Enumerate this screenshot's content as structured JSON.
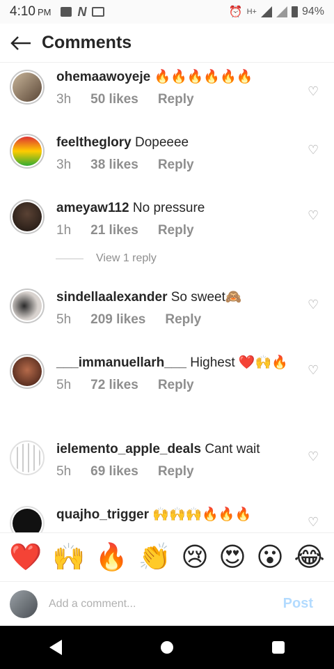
{
  "status": {
    "time": "4:10",
    "ampm": "PM",
    "network": "H+",
    "battery": "94%"
  },
  "header": {
    "title": "Comments"
  },
  "comments": [
    {
      "user": "ohemaawoyeje",
      "text": "🔥🔥🔥🔥🔥🔥",
      "time": "3h",
      "likes": "50 likes",
      "reply": "Reply",
      "avatar_color": "#8a7560"
    },
    {
      "user": "feeltheglory",
      "text": "Dopeeee",
      "time": "3h",
      "likes": "38 likes",
      "reply": "Reply",
      "avatar_color": "#6b7a3c"
    },
    {
      "user": "ameyaw112",
      "text": "No pressure",
      "time": "1h",
      "likes": "21 likes",
      "reply": "Reply",
      "avatar_color": "#3b2b22"
    },
    {
      "user": "sindellaalexander",
      "text": "So sweet🙈",
      "time": "5h",
      "likes": "209 likes",
      "reply": "Reply",
      "avatar_color": "#c7b8b0"
    },
    {
      "user": "___immanuellarh___",
      "text": "Highest ❤️🙌🔥",
      "time": "5h",
      "likes": "72 likes",
      "reply": "Reply",
      "avatar_color": "#7a3a2a"
    },
    {
      "user": "ielemento_apple_deals",
      "text": "Cant wait",
      "time": "5h",
      "likes": "69 likes",
      "reply": "Reply",
      "avatar_color": "#e8e8e8"
    },
    {
      "user": "quajho_trigger",
      "text": "🙌🙌🙌🔥🔥🔥",
      "time": "",
      "likes": "",
      "reply": "",
      "avatar_color": "#111111"
    }
  ],
  "view_reply": "View 1 reply",
  "reactions": [
    "❤️",
    "🙌",
    "🔥",
    "👏",
    "😢",
    "😍",
    "😮",
    "😂"
  ],
  "composer": {
    "placeholder": "Add a comment...",
    "post_label": "Post"
  }
}
